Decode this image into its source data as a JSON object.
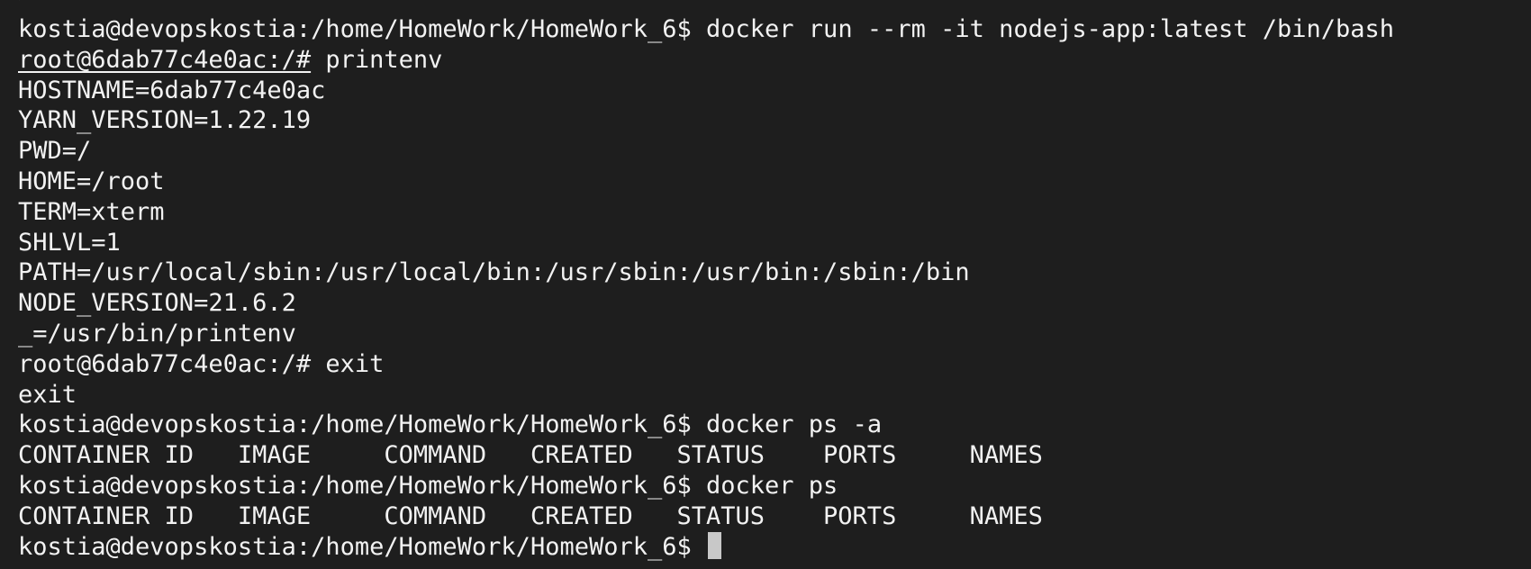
{
  "terminal": {
    "top_partial": ">",
    "lines": [
      {
        "prompt": "kostia@devopskostia:/home/HomeWork/HomeWork_6$",
        "command": "docker run --rm -it nodejs-app:latest /bin/bash"
      },
      {
        "prompt": "root@6dab77c4e0ac:/#",
        "command": "printenv"
      },
      {
        "output": "HOSTNAME=6dab77c4e0ac"
      },
      {
        "output": "YARN_VERSION=1.22.19"
      },
      {
        "output": "PWD=/"
      },
      {
        "output": "HOME=/root"
      },
      {
        "output": "TERM=xterm"
      },
      {
        "output": "SHLVL=1"
      },
      {
        "output": "PATH=/usr/local/sbin:/usr/local/bin:/usr/sbin:/usr/bin:/sbin:/bin"
      },
      {
        "output": "NODE_VERSION=21.6.2"
      },
      {
        "output": "_=/usr/bin/printenv"
      },
      {
        "prompt": "root@6dab77c4e0ac:/#",
        "command": "exit"
      },
      {
        "output": "exit"
      },
      {
        "prompt": "kostia@devopskostia:/home/HomeWork/HomeWork_6$",
        "command": "docker ps -a"
      },
      {
        "output": "CONTAINER ID   IMAGE     COMMAND   CREATED   STATUS    PORTS     NAMES"
      },
      {
        "prompt": "kostia@devopskostia:/home/HomeWork/HomeWork_6$",
        "command": "docker ps"
      },
      {
        "output": "CONTAINER ID   IMAGE     COMMAND   CREATED   STATUS    PORTS     NAMES"
      },
      {
        "prompt": "kostia@devopskostia:/home/HomeWork/HomeWork_6$",
        "command": ""
      }
    ]
  },
  "colors": {
    "background": "#1e1e1e",
    "text": "#f2f2f2",
    "cursor": "#c8c8c8"
  }
}
